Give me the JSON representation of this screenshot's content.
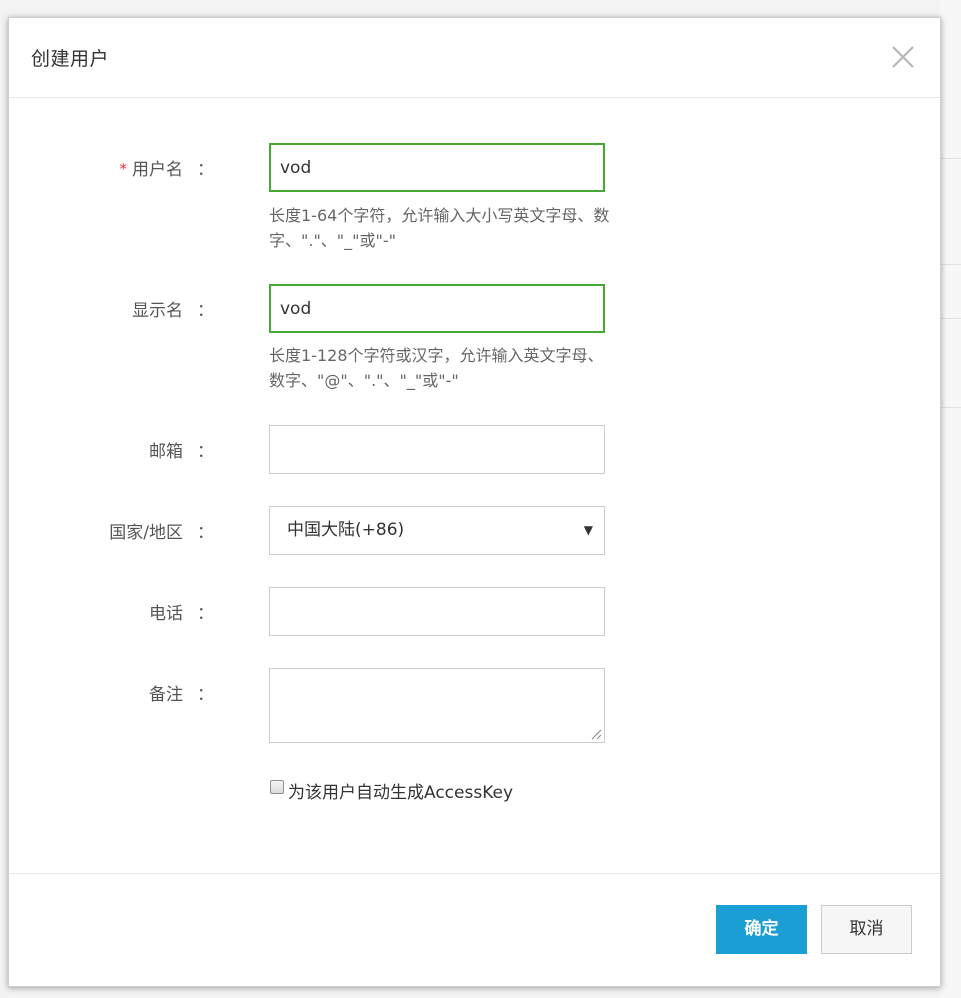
{
  "dialog": {
    "title": "创建用户",
    "close_icon": "close-icon"
  },
  "form": {
    "username": {
      "label": "用户名",
      "colon": "：",
      "required_mark": "*",
      "value": "vod",
      "hint": "长度1-64个字符，允许输入大小写英文字母、数字、\".\"、\"_\"或\"-\""
    },
    "display_name": {
      "label": "显示名",
      "colon": "：",
      "value": "vod",
      "hint": "长度1-128个字符或汉字，允许输入英文字母、数字、\"@\"、\".\"、\"_\"或\"-\""
    },
    "email": {
      "label": "邮箱",
      "colon": "：",
      "value": ""
    },
    "region": {
      "label": "国家/地区",
      "colon": "：",
      "selected": "中国大陆(+86)",
      "arrow": "▼"
    },
    "phone": {
      "label": "电话",
      "colon": "：",
      "value": ""
    },
    "remark": {
      "label": "备注",
      "colon": "：",
      "value": ""
    },
    "accesskey_checkbox": {
      "label": "为该用户自动生成AccessKey",
      "checked": false
    }
  },
  "footer": {
    "ok_label": "确定",
    "cancel_label": "取消"
  },
  "colors": {
    "primary": "#1a9ed4",
    "valid_border": "#44a832",
    "required": "#e4393c"
  }
}
